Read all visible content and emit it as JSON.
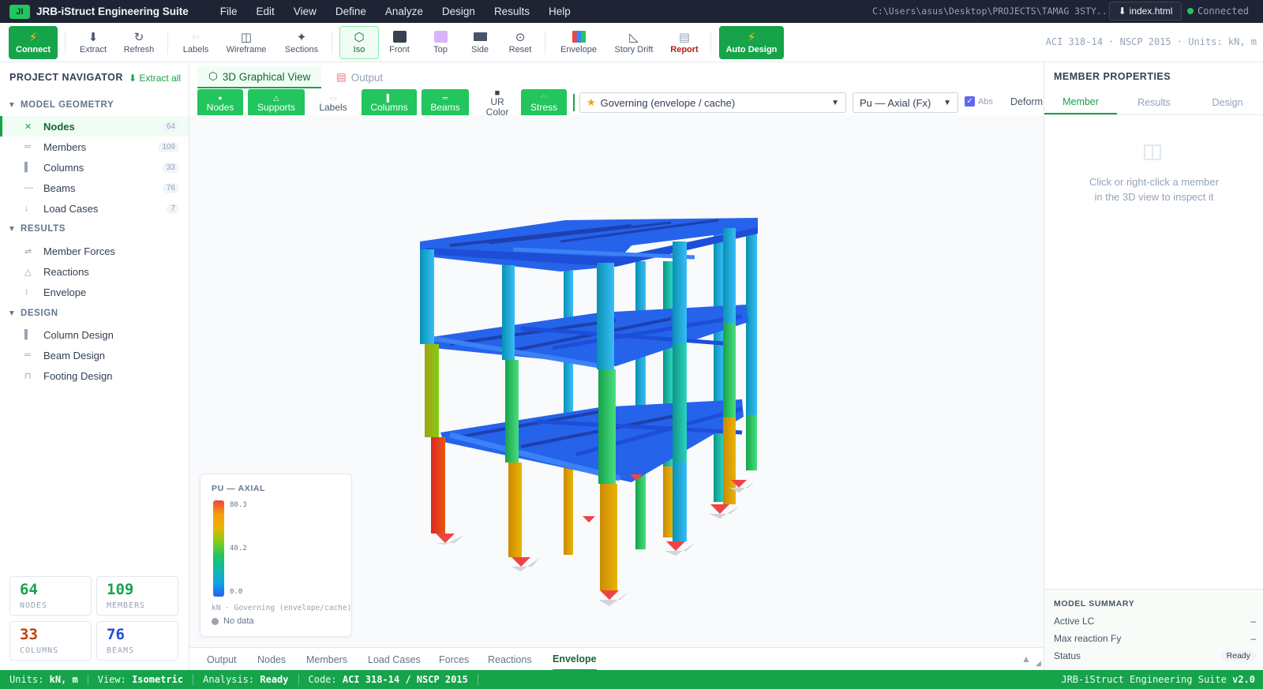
{
  "app": {
    "logo": "JI",
    "title": "JRB-iStruct Engineering Suite",
    "menu": [
      "File",
      "Edit",
      "View",
      "Define",
      "Analyze",
      "Design",
      "Results",
      "Help"
    ],
    "file_path": "C:\\Users\\asus\\Desktop\\PROJECTS\\TAMAG 3STY...",
    "file_tab": "index.html",
    "connection_status": "Connected"
  },
  "toolbar": {
    "connect": "Connect",
    "extract": "Extract",
    "refresh": "Refresh",
    "labels": "Labels",
    "wireframe": "Wireframe",
    "sections": "Sections",
    "iso": "Iso",
    "front": "Front",
    "top": "Top",
    "side": "Side",
    "reset": "Reset",
    "envelope": "Envelope",
    "story_drift": "Story Drift",
    "report": "Report",
    "auto_design": "Auto Design",
    "code_info": "ACI 318-14 · NSCP 2015 · Units: kN, m"
  },
  "navigator": {
    "title": "PROJECT NAVIGATOR",
    "extract_all": "Extract all",
    "sections": {
      "model_geometry": "MODEL GEOMETRY",
      "results": "RESULTS",
      "design": "DESIGN"
    },
    "geometry_items": [
      {
        "label": "Nodes",
        "count": "64",
        "icon": "x-icon"
      },
      {
        "label": "Members",
        "count": "109",
        "icon": "members-icon"
      },
      {
        "label": "Columns",
        "count": "33",
        "icon": "column-icon"
      },
      {
        "label": "Beams",
        "count": "76",
        "icon": "beam-icon"
      },
      {
        "label": "Load Cases",
        "count": "7",
        "icon": "arrow-down-icon"
      }
    ],
    "result_items": [
      {
        "label": "Member Forces",
        "icon": "forces-icon"
      },
      {
        "label": "Reactions",
        "icon": "triangle-icon"
      },
      {
        "label": "Envelope",
        "icon": "updown-icon"
      }
    ],
    "design_items": [
      {
        "label": "Column Design",
        "icon": "column-icon"
      },
      {
        "label": "Beam Design",
        "icon": "beam-icon"
      },
      {
        "label": "Footing Design",
        "icon": "footing-icon"
      }
    ],
    "stats": [
      {
        "value": "64",
        "label": "NODES",
        "color": "#16a34a"
      },
      {
        "value": "109",
        "label": "MEMBERS",
        "color": "#16a34a"
      },
      {
        "value": "33",
        "label": "COLUMNS",
        "color": "#c2410c"
      },
      {
        "value": "76",
        "label": "BEAMS",
        "color": "#1d4ed8"
      }
    ]
  },
  "center": {
    "tabs": [
      "3D Graphical View",
      "Output"
    ],
    "view_buttons": {
      "nodes": "Nodes",
      "supports": "Supports",
      "labels": "Labels",
      "columns": "Columns",
      "beams": "Beams",
      "ur_color": "UR Color",
      "stress": "Stress"
    },
    "combo_select": "Governing (envelope / cache)",
    "result_select": "Pu — Axial (Fx)",
    "abs_label": "Abs",
    "deform_label": "Deform",
    "legend": {
      "title": "PU — AXIAL",
      "max": "80.3",
      "mid": "40.2",
      "min": "0.0",
      "caption": "kN · Governing (envelope/cache)",
      "no_data": "No data"
    },
    "bottom_tabs": [
      "Output",
      "Nodes",
      "Members",
      "Load Cases",
      "Forces",
      "Reactions",
      "Envelope"
    ]
  },
  "props": {
    "title": "MEMBER PROPERTIES",
    "tabs": [
      "Member",
      "Results",
      "Design"
    ],
    "empty_line1": "Click or right-click a member",
    "empty_line2": "in the 3D view to inspect it",
    "summary": {
      "title": "MODEL SUMMARY",
      "active_lc_label": "Active LC",
      "active_lc_value": "–",
      "max_reaction_label": "Max reaction Fy",
      "max_reaction_value": "–",
      "status_label": "Status",
      "status_value": "Ready"
    }
  },
  "statusbar": {
    "units_label": "Units:",
    "units_value": "kN, m",
    "view_label": "View:",
    "view_value": "Isometric",
    "analysis_label": "Analysis:",
    "analysis_value": "Ready",
    "code_label": "Code:",
    "code_value": "ACI 318-14 / NSCP 2015",
    "suite": "JRB-iStruct Engineering Suite",
    "version": "v2.0"
  },
  "colors": {
    "accent": "#16a34a",
    "titlebar": "#1e2433",
    "beam_blue": "#2563eb"
  }
}
